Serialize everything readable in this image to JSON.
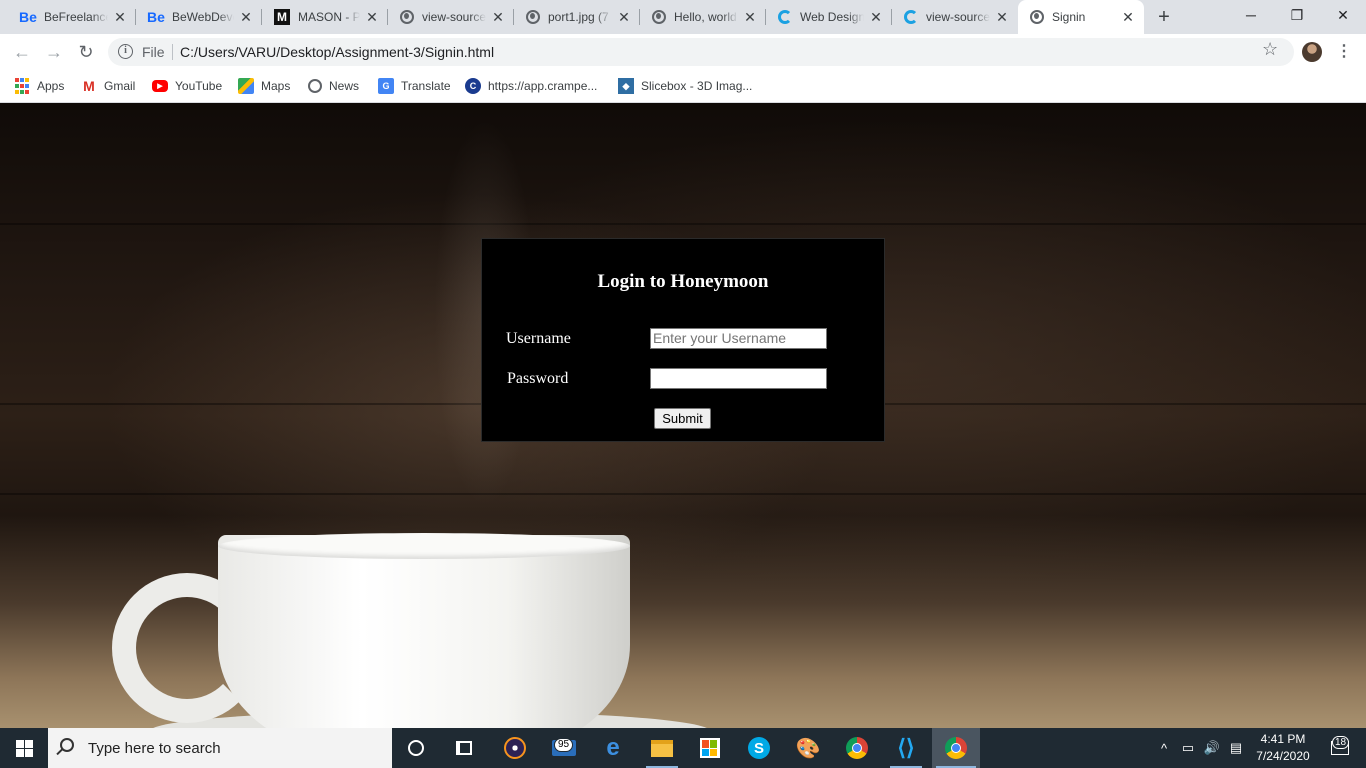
{
  "browser": {
    "tabs": [
      {
        "title": "BeFreelancer",
        "icon": "behance-icon"
      },
      {
        "title": "BeWebDeveloper",
        "icon": "behance-icon"
      },
      {
        "title": "MASON - Portfolio",
        "icon": "mason-icon"
      },
      {
        "title": "view-source",
        "icon": "globe-icon"
      },
      {
        "title": "port1.jpg (7",
        "icon": "globe-icon"
      },
      {
        "title": "Hello, world",
        "icon": "globe-icon"
      },
      {
        "title": "Web Design",
        "icon": "web-icon"
      },
      {
        "title": "view-source",
        "icon": "web-icon"
      },
      {
        "title": "Signin",
        "icon": "globe-icon",
        "active": true
      }
    ],
    "new_tab": "+",
    "window_controls": {
      "minimize": "─",
      "maximize": "❐",
      "close": "✕"
    },
    "toolbar": {
      "back": "←",
      "forward": "→",
      "reload": "↻",
      "scheme_label": "File",
      "url": "C:/Users/VARU/Desktop/Assignment-3/Signin.html",
      "star": "☆",
      "menu": "⋮"
    },
    "bookmarks": [
      {
        "label": "Apps",
        "icon": "apps-grid-icon"
      },
      {
        "label": "Gmail",
        "icon": "gmail-icon"
      },
      {
        "label": "YouTube",
        "icon": "youtube-icon"
      },
      {
        "label": "Maps",
        "icon": "maps-icon"
      },
      {
        "label": "News",
        "icon": "news-icon"
      },
      {
        "label": "Translate",
        "icon": "translate-icon"
      },
      {
        "label": "https://app.crampe...",
        "icon": "crampete-icon"
      },
      {
        "label": "Slicebox - 3D Imag...",
        "icon": "slicebox-icon"
      }
    ]
  },
  "page": {
    "login": {
      "title": "Login to Honeymoon",
      "username_label": "Username",
      "username_placeholder": "Enter your Username",
      "password_label": "Password",
      "password_value": "",
      "submit_label": "Submit"
    }
  },
  "taskbar": {
    "search_placeholder": "Type here to search",
    "mail_badge": "95",
    "skype_letter": "S",
    "edge_letter": "e",
    "tray": {
      "chevron": "^",
      "time": "4:41 PM",
      "date": "7/24/2020",
      "notification_count": "18"
    }
  },
  "colors": {
    "login_bg": "#000000",
    "taskbar_bg": "#1f2a33",
    "tabstrip_bg": "#dee1e6"
  }
}
